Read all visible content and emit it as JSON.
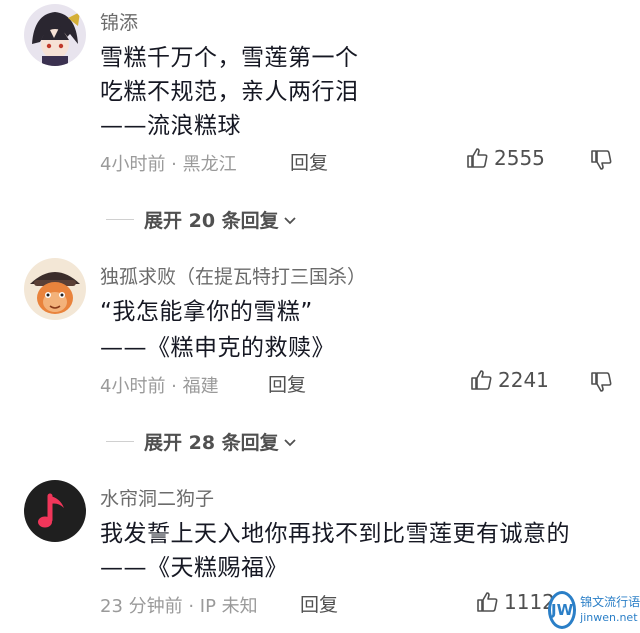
{
  "comments": [
    {
      "username": "锦添",
      "lines": [
        "雪糕千万个，雪莲第一个",
        "吃糕不规范，亲人两行泪",
        "——流浪糕球"
      ],
      "meta": "4小时前 · 黑龙江",
      "reply_label": "回复",
      "likes": "2555",
      "expand_label": "展开 20 条回复"
    },
    {
      "username": "独孤求败（在提瓦特打三国杀）",
      "lines": [
        "“我怎能拿你的雪糕”",
        "——《糕申克的救赎》"
      ],
      "meta": "4小时前 · 福建",
      "reply_label": "回复",
      "likes": "2241",
      "expand_label": "展开 28 条回复"
    },
    {
      "username": "水帘洞二狗子",
      "lines": [
        "我发誓上天入地你再找不到比雪莲更有诚意的",
        "——《天糕赐福》"
      ],
      "meta": "23 分钟前 · IP 未知",
      "reply_label": "回复",
      "likes": "1112"
    }
  ],
  "watermark": {
    "logo_text": "JW",
    "site_cn": "锦文流行语",
    "site_en": "jinwen.net"
  },
  "colors": {
    "text_primary": "#161823",
    "text_secondary": "#9a9a9a",
    "music_avatar_bg": "#1f1f1f",
    "music_note": "#f0365a",
    "watermark_blue": "#2b7fc7"
  },
  "icons": {
    "like": "thumb-up-icon",
    "dislike": "thumb-down-icon",
    "expand": "chevron-down-icon",
    "music": "music-note-icon"
  }
}
